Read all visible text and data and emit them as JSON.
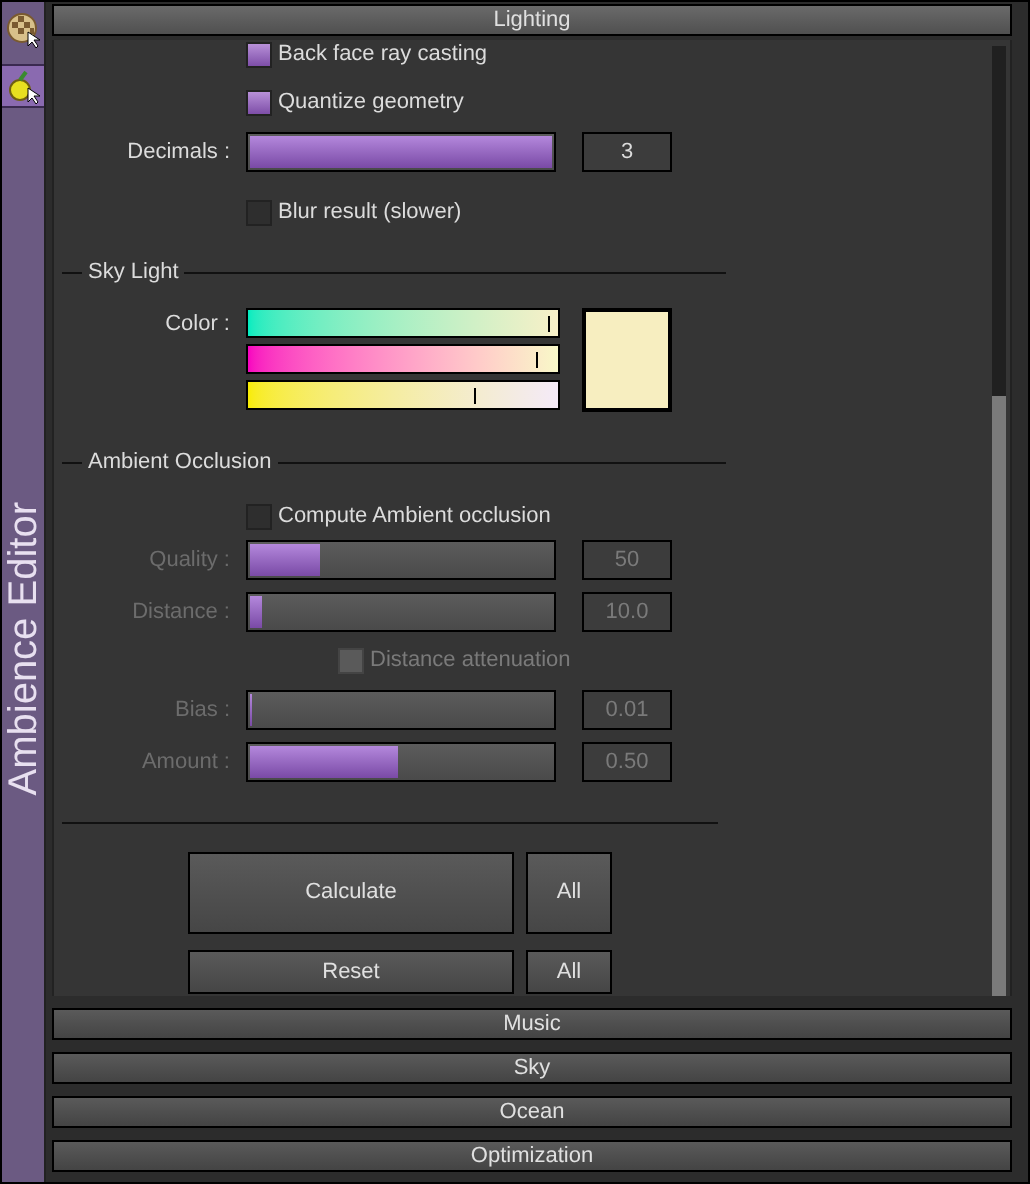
{
  "sidebar": {
    "title": "Ambience Editor",
    "tabs": [
      {
        "kind": "ball",
        "selected": false
      },
      {
        "kind": "figure",
        "selected": true
      }
    ]
  },
  "panel": {
    "title": "Lighting",
    "top_options": [
      {
        "kind": "checkbox",
        "label": "Back face ray casting",
        "checked": true
      },
      {
        "kind": "checkbox",
        "label": "Quantize geometry",
        "checked": true
      },
      {
        "kind": "slider",
        "label": "Decimals :",
        "level": 1.0,
        "value": "3"
      },
      {
        "kind": "checkbox",
        "label": "Blur result (slower)",
        "checked": false
      }
    ],
    "sky_light": {
      "title": "Sky Light",
      "label": "Color :",
      "channels": [
        {
          "level": 0.97
        },
        {
          "level": 0.93
        },
        {
          "level": 0.73
        }
      ],
      "color": "#f7eec0"
    },
    "ambient_occlusion": {
      "title": "Ambient Occlusion",
      "options": [
        {
          "kind": "checkbox",
          "label": "Compute Ambient occlusion",
          "checked": false
        },
        {
          "kind": "slider",
          "label": "Quality :",
          "level": 0.23,
          "value": "50",
          "disabled": true
        },
        {
          "kind": "slider",
          "label": "Distance :",
          "level": 0.04,
          "value": "10.0",
          "disabled": true
        },
        {
          "kind": "checkbox",
          "label": "Distance attenuation",
          "checked": true,
          "disabled": true
        },
        {
          "kind": "slider",
          "label": "Bias :",
          "level": 0,
          "value": "0.01",
          "disabled": true
        },
        {
          "kind": "slider",
          "label": "Amount :",
          "level": 0.49,
          "value": "0.50",
          "disabled": true
        }
      ]
    },
    "actions": [
      {
        "label": "Calculate",
        "all_label": "All"
      },
      {
        "label": "Reset",
        "all_label": "All"
      }
    ]
  },
  "sections": [
    {
      "title": "Music"
    },
    {
      "title": "Sky"
    },
    {
      "title": "Ocean"
    },
    {
      "title": "Optimization"
    }
  ]
}
